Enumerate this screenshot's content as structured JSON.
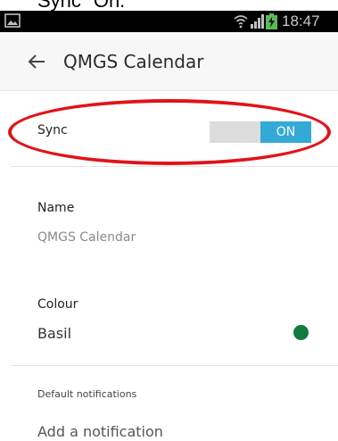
{
  "caption": {
    "text": "Sync \"On.\""
  },
  "status_bar": {
    "time": "18:47",
    "icons": [
      "image-icon",
      "wifi-icon",
      "signal-icon",
      "battery-charging-icon"
    ]
  },
  "app_bar": {
    "back_icon": "arrow-left-icon",
    "title": "QMGS Calendar"
  },
  "sync": {
    "label": "Sync",
    "toggle_state": "ON",
    "toggle_color": "#33a9d8"
  },
  "name": {
    "label": "Name",
    "value": "QMGS Calendar"
  },
  "colour": {
    "label": "Colour",
    "value": "Basil",
    "swatch_color": "#137a3f"
  },
  "notifications": {
    "header": "Default notifications",
    "add_label": "Add a notification"
  },
  "annotation": {
    "color": "#e1131a"
  }
}
